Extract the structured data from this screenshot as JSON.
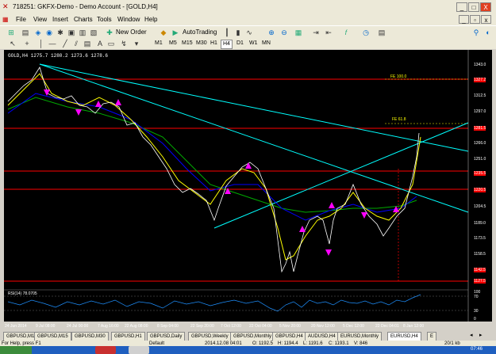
{
  "window": {
    "title": "718251: GKFX-Demo - Demo Account - [GOLD,H4]",
    "minimize": "_",
    "maximize": "□",
    "close": "X"
  },
  "menu": [
    "File",
    "View",
    "Insert",
    "Charts",
    "Tools",
    "Window",
    "Help"
  ],
  "toolbar": {
    "new_order": "New Order",
    "autotrading": "AutoTrading",
    "search_placeholder": ""
  },
  "timeframes": [
    "M1",
    "M5",
    "M15",
    "M30",
    "H1",
    "H4",
    "D1",
    "W1",
    "MN"
  ],
  "active_timeframe": "H4",
  "chart": {
    "header": "GOLD,H4  1275.7 1280.2 1273.6 1278.6",
    "price_labels": [
      "1343.0",
      "1327.2",
      "1312.5",
      "1297.0",
      "1281.5",
      "1266.0",
      "1251.0",
      "1235.5",
      "1220.5",
      "1204.5",
      "1189.0",
      "1173.5",
      "1158.5",
      "1142.5",
      "1127.5"
    ],
    "fib_labels": [
      "FE 100.0",
      "FE 61.8"
    ],
    "rsi_header": "RSI(14) 78.0705",
    "rsi_scale": [
      "100",
      "70",
      "30",
      "0"
    ],
    "date_labels": [
      "24 Jun 2014",
      "9 Jul 08:00",
      "24 Jul 00:00",
      "7 Aug 16:00",
      "22 Aug 08:00",
      "8 Sep 04:00",
      "22 Sep 20:00",
      "7 Oct 12:00",
      "22 Oct 04:00",
      "5 Nov 20:00",
      "20 Nov 12:00",
      "5 Dec 12:00",
      "22 Dec 04:01",
      "8 Jan 12:00"
    ],
    "colors": {
      "background": "#000000",
      "candles": "#ffffff",
      "ma_fast": "#ffff00",
      "ma_mid": "#0000ff",
      "ma_slow": "#00aa00",
      "hline": "#ff0000",
      "trendline": "#00ffff",
      "arrows": "#ff00ff"
    }
  },
  "tabs": [
    "GBPUSD,M15",
    "GBPUSD,M15",
    "GBPUSD,M30",
    "GBPUSD,H1",
    "GBPUSD,Daily",
    "GBPUSD,Weekly",
    "GBPUSD,Monthly",
    "GBPUSD,H4",
    "AUDUSD,H4",
    "EURUSD,Monthly",
    "EURUSD,H4",
    "E"
  ],
  "active_tab": "EURUSD,H4",
  "status": {
    "help": "For Help, press F1",
    "profile": "Default",
    "datetime": "2014.12.08 04:01",
    "open": "O: 1192.5",
    "high": "H: 1194.4",
    "low": "L: 1191.6",
    "close": "C: 1193.1",
    "volume": "V: 846",
    "traffic": "20/1 kb",
    "clock": "07:46"
  }
}
